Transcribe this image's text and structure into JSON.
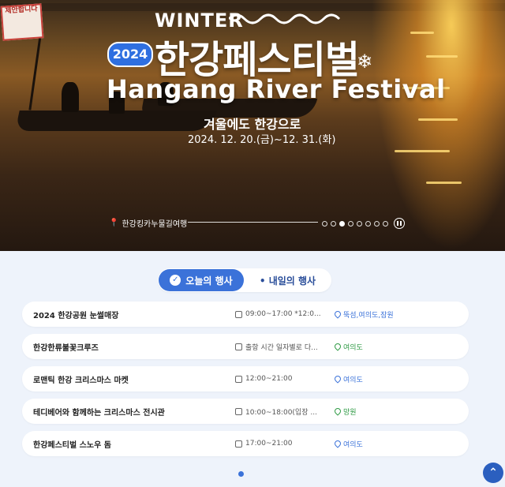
{
  "hero": {
    "winter": "WINTER",
    "year": "2024",
    "title_ko": "한강페스티벌",
    "title_en": "Hangang River Festival",
    "subtitle": "겨울에도 한강으로",
    "dates": "2024. 12. 20.(금)~12. 31.(화)",
    "location": "한강킹카누물길여행",
    "flag_text": "제안합니다",
    "slide_active_index": 2,
    "slide_count": 8
  },
  "tabs": {
    "today": "오늘의 행사",
    "tomorrow": "• 내일의 행사"
  },
  "events": [
    {
      "name": "2024 한강공원 눈썰매장",
      "time": "09:00~17:00 *12:0...",
      "place": "뚝섬,여의도,잠원",
      "place_color": "blue"
    },
    {
      "name": "한강한류불꽃크루즈",
      "time": "출항 시간 일자별로 다...",
      "place": "여의도",
      "place_color": "green"
    },
    {
      "name": "로맨틱 한강 크리스마스 마켓",
      "time": "12:00~21:00",
      "place": "여의도",
      "place_color": "blue"
    },
    {
      "name": "테디베어와 함께하는 크리스마스 전시관",
      "time": "10:00~18:00(입장 ...",
      "place": "망원",
      "place_color": "green"
    },
    {
      "name": "한강페스티벌 스노우 돔",
      "time": "17:00~21:00",
      "place": "여의도",
      "place_color": "blue"
    }
  ],
  "colors": {
    "accent": "#3b72d9",
    "green": "#2e9a44"
  },
  "icons": {
    "top": "double-chevron-up-icon",
    "snow": "snowflake-icon",
    "location": "map-pin-icon"
  }
}
